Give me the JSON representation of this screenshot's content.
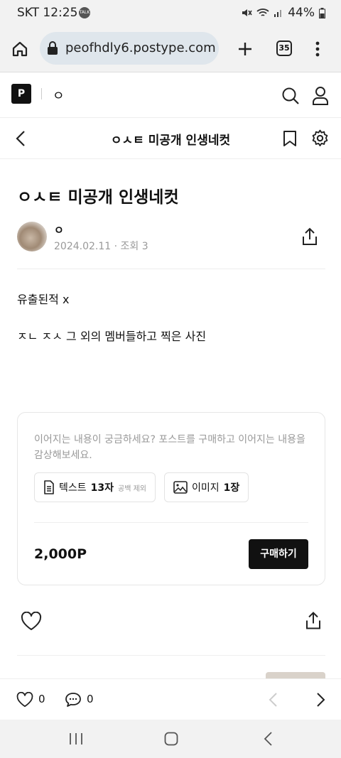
{
  "status_bar": {
    "time": "SKT 12:25",
    "talk_badge": "TALK",
    "battery": "44%"
  },
  "browser": {
    "url": "peofhdly6.postype.com",
    "tab_count": "35"
  },
  "site_header": {
    "logo_text": "P",
    "blog_name": "ㅇ"
  },
  "post_nav": {
    "title": "ㅇㅅㅌ 미공개 인생네컷"
  },
  "post": {
    "title": "ㅇㅅㅌ 미공개 인생네컷",
    "author": "ㅇ",
    "date": "2024.02.11",
    "views": "· 조회 3",
    "paragraphs": [
      "유출된적 x",
      "ㅈㄴ ㅈㅅ 그 외의 멤버들하고 찍은 사진"
    ]
  },
  "paywall": {
    "notice": "이어지는 내용이 궁금하세요? 포스트를 구매하고 이어지는 내용을 감상해보세요.",
    "text_chip": {
      "label": "텍스트",
      "count": "13자",
      "note": "공백 제외"
    },
    "image_chip": {
      "label": "이미지",
      "count": "1장"
    },
    "price": "2,000P",
    "buy_label": "구매하기"
  },
  "bottom_bar": {
    "likes": "0",
    "comments": "0"
  },
  "icons": [
    "home-icon",
    "lock-icon",
    "plus-icon",
    "more-vert-icon",
    "search-icon",
    "user-icon",
    "back-icon",
    "bookmark-icon",
    "gear-icon",
    "share-icon",
    "document-icon",
    "image-icon",
    "heart-icon",
    "comment-icon",
    "chevron-left-icon",
    "chevron-right-icon",
    "recents-icon",
    "home-circle-icon",
    "system-back-icon"
  ]
}
